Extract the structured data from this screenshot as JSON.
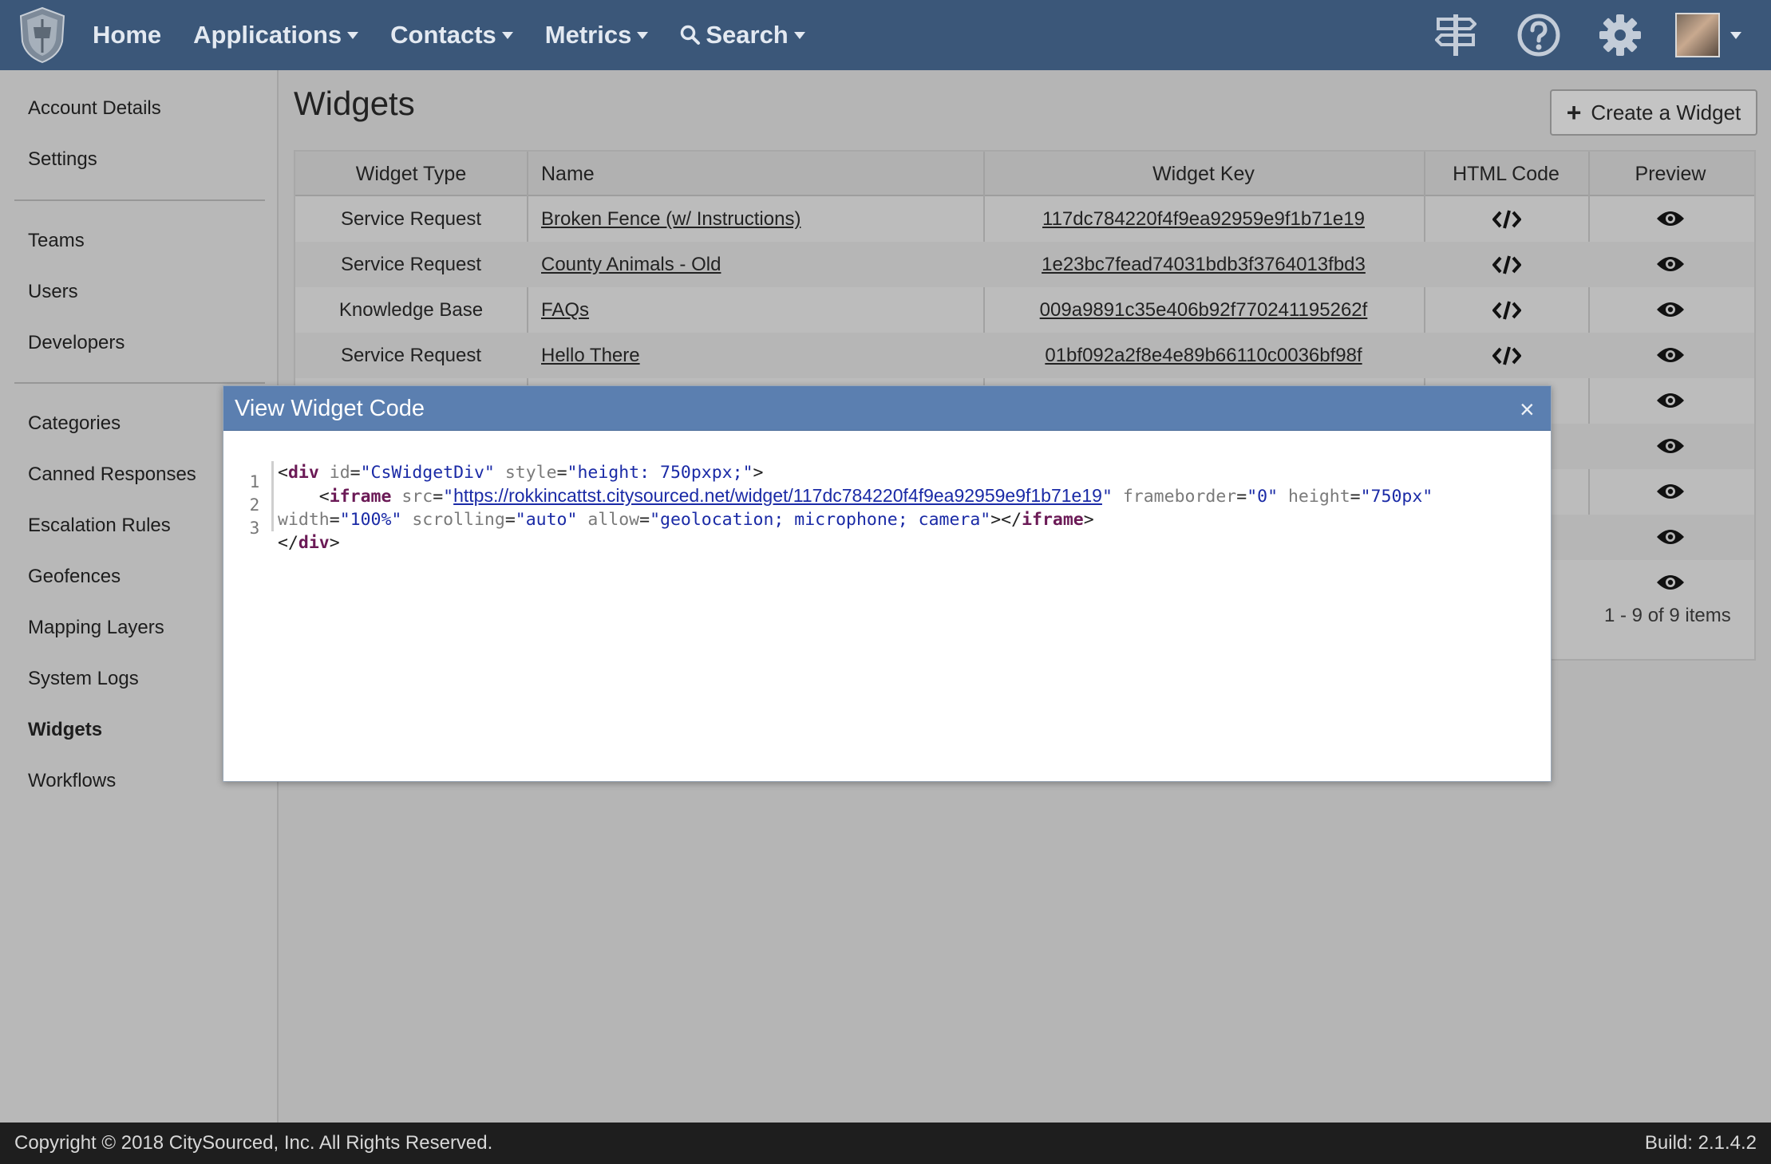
{
  "topnav": {
    "items": [
      {
        "label": "Home",
        "dropdown": false
      },
      {
        "label": "Applications",
        "dropdown": true
      },
      {
        "label": "Contacts",
        "dropdown": true
      },
      {
        "label": "Metrics",
        "dropdown": true
      },
      {
        "label": "Search",
        "dropdown": true
      }
    ],
    "icons": [
      "shield-logo-icon",
      "signpost-icon",
      "help-icon",
      "gear-icon",
      "avatar"
    ]
  },
  "sidebar": {
    "group1": [
      "Account Details",
      "Settings"
    ],
    "group2": [
      "Teams",
      "Users",
      "Developers"
    ],
    "group3": [
      "Categories",
      "Canned Responses",
      "Escalation Rules",
      "Geofences",
      "Mapping Layers",
      "System Logs",
      "Widgets",
      "Workflows"
    ],
    "active": "Widgets"
  },
  "main": {
    "title": "Widgets",
    "create_label": "Create a Widget"
  },
  "grid": {
    "columns": [
      "Widget Type",
      "Name",
      "Widget Key",
      "HTML Code",
      "Preview"
    ],
    "rows": [
      {
        "type": "Service Request",
        "name": "Broken Fence (w/ Instructions)",
        "key": "117dc784220f4f9ea92959e9f1b71e19"
      },
      {
        "type": "Service Request",
        "name": "County Animals - Old",
        "key": "1e23bc7fead74031bdb3f3764013fbd3"
      },
      {
        "type": "Knowledge Base",
        "name": "FAQs",
        "key": "009a9891c35e406b92f770241195262f"
      },
      {
        "type": "Service Request",
        "name": "Hello There",
        "key": "01bf092a2f8e4e89b66110c0036bf98f"
      }
    ],
    "pager": "1 - 9 of 9 items"
  },
  "modal": {
    "title": "View Widget Code",
    "close": "×",
    "line_numbers": [
      "1",
      "2",
      "3"
    ],
    "code": {
      "l1_tag": "div",
      "l1_attr1": "id",
      "l1_val1": "\"CsWidgetDiv\"",
      "l1_attr2": "style",
      "l1_val2": "\"height: 750pxpx;\"",
      "l2_tag": "iframe",
      "l2_attr_src": "src",
      "l2_url": "https://rokkincattst.citysourced.net/widget/117dc784220f4f9ea92959e9f1b71e19",
      "l2_attr_fb": "frameborder",
      "l2_val_fb": "\"0\"",
      "l2_attr_h": "height",
      "l2_val_h": "\"750px\"",
      "l3_attr_w": "width",
      "l3_val_w": "\"100%\"",
      "l3_attr_s": "scrolling",
      "l3_val_s": "\"auto\"",
      "l3_attr_a": "allow",
      "l3_val_a": "\"geolocation; microphone; camera\"",
      "l3_close_tag": "iframe",
      "l4_close_tag": "div"
    }
  },
  "footer": {
    "copyright": "Copyright © 2018 CitySourced, Inc.   All Rights Reserved.",
    "build": "Build: 2.1.4.2"
  }
}
